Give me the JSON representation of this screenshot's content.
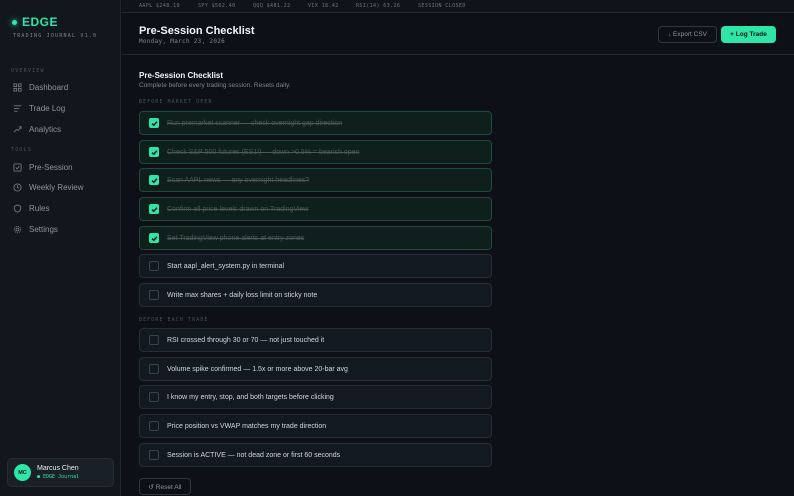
{
  "brand": {
    "name": "EDGE",
    "subtitle": "TRADING JOURNAL V1.0"
  },
  "sidebar": {
    "overview_label": "OVERVIEW",
    "tools_label": "TOOLS",
    "items": [
      {
        "label": "Dashboard",
        "icon": "grid-icon"
      },
      {
        "label": "Trade Log",
        "icon": "list-icon"
      },
      {
        "label": "Analytics",
        "icon": "trend-icon"
      },
      {
        "label": "Pre-Session",
        "icon": "checkbox-icon"
      },
      {
        "label": "Weekly Review",
        "icon": "clock-icon"
      },
      {
        "label": "Rules",
        "icon": "shield-icon"
      },
      {
        "label": "Settings",
        "icon": "gear-icon"
      }
    ]
  },
  "user": {
    "initials": "MC",
    "name": "Marcus Chen",
    "subtitle": "● EDGE Journal"
  },
  "ticker": {
    "items": [
      "AAPL $248.19",
      "SPY $562.40",
      "QQQ $481.22",
      "VIX 18.42",
      "RSI(14) 63.26",
      "SESSION CLOSED"
    ]
  },
  "header": {
    "title": "Pre-Session Checklist",
    "date": "Monday, March 23, 2026",
    "export_label": "↓ Export CSV",
    "log_label": "+ Log Trade"
  },
  "checklist": {
    "title": "Pre-Session Checklist",
    "subtitle": "Complete before every trading session. Resets daily.",
    "group1_label": "BEFORE MARKET OPEN",
    "group2_label": "BEFORE EACH TRADE",
    "items": [
      {
        "text": "Run premarket scanner — check overnight gap direction",
        "checked": true
      },
      {
        "text": "Check S&P 500 futures (ES1!) — down >0.5% = bearish open",
        "checked": true
      },
      {
        "text": "Scan AAPL news — any overnight headlines?",
        "checked": true
      },
      {
        "text": "Confirm all price levels drawn on TradingView",
        "checked": true
      },
      {
        "text": "Set TradingView phone alerts at entry zones",
        "checked": true
      },
      {
        "text": "Start aapl_alert_system.py in terminal",
        "checked": false
      },
      {
        "text": "Write max shares + daily loss limit on sticky note",
        "checked": false
      },
      {
        "text": "RSI crossed through 30 or 70 — not just touched it",
        "checked": false
      },
      {
        "text": "Volume spike confirmed — 1.5x or more above 20-bar avg",
        "checked": false
      },
      {
        "text": "I know my entry, stop, and both targets before clicking",
        "checked": false
      },
      {
        "text": "Price position vs VWAP matches my trade direction",
        "checked": false
      },
      {
        "text": "Session is ACTIVE — not dead zone or first 60 seconds",
        "checked": false
      }
    ],
    "reset_label": "↺ Reset All"
  },
  "colors": {
    "accent": "#2ee6a6",
    "background": "#0d1117"
  }
}
